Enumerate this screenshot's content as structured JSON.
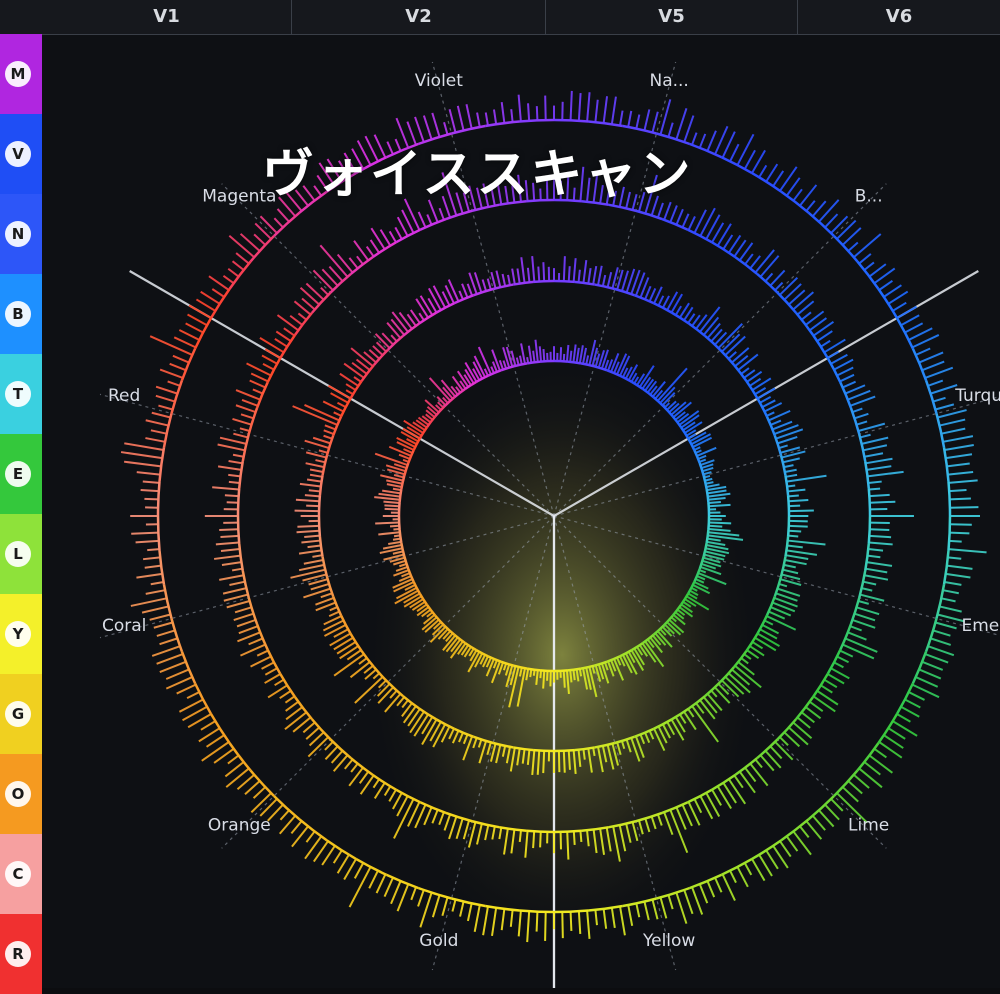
{
  "title": "ヴォイススキャン",
  "columns": [
    {
      "label": "V1"
    },
    {
      "label": "V2"
    },
    {
      "label": "V5"
    },
    {
      "label": "V6"
    }
  ],
  "sidebar": {
    "items": [
      {
        "letter": "M",
        "color": "#b026e0"
      },
      {
        "letter": "V",
        "color": "#1f4ef5"
      },
      {
        "letter": "N",
        "color": "#2d56f8"
      },
      {
        "letter": "B",
        "color": "#1e90ff"
      },
      {
        "letter": "T",
        "color": "#3ad0e0"
      },
      {
        "letter": "E",
        "color": "#34c83c"
      },
      {
        "letter": "L",
        "color": "#8ee23a"
      },
      {
        "letter": "Y",
        "color": "#f4f02a"
      },
      {
        "letter": "G",
        "color": "#f0d020"
      },
      {
        "letter": "O",
        "color": "#f59a20"
      },
      {
        "letter": "C",
        "color": "#f6a0a0"
      },
      {
        "letter": "R",
        "color": "#f03030"
      }
    ]
  },
  "zones": [
    {
      "label": "Violet",
      "color": "#7a3cff"
    },
    {
      "label": "Na...",
      "color": "#2b4bff"
    },
    {
      "label": "B...",
      "color": "#1e6dff"
    },
    {
      "label": "Turquo",
      "color": "#3fd0e0"
    },
    {
      "label": "Emer",
      "color": "#30c840"
    },
    {
      "label": "Lime",
      "color": "#9be22a"
    },
    {
      "label": "Yellow",
      "color": "#f4ea20"
    },
    {
      "label": "Gold",
      "color": "#f2c81c"
    },
    {
      "label": "Orange",
      "color": "#f59c22"
    },
    {
      "label": "Coral",
      "color": "#f7907a"
    },
    {
      "label": "Red",
      "color": "#ff4424"
    },
    {
      "label": "Magenta",
      "color": "#e030e0"
    }
  ]
}
